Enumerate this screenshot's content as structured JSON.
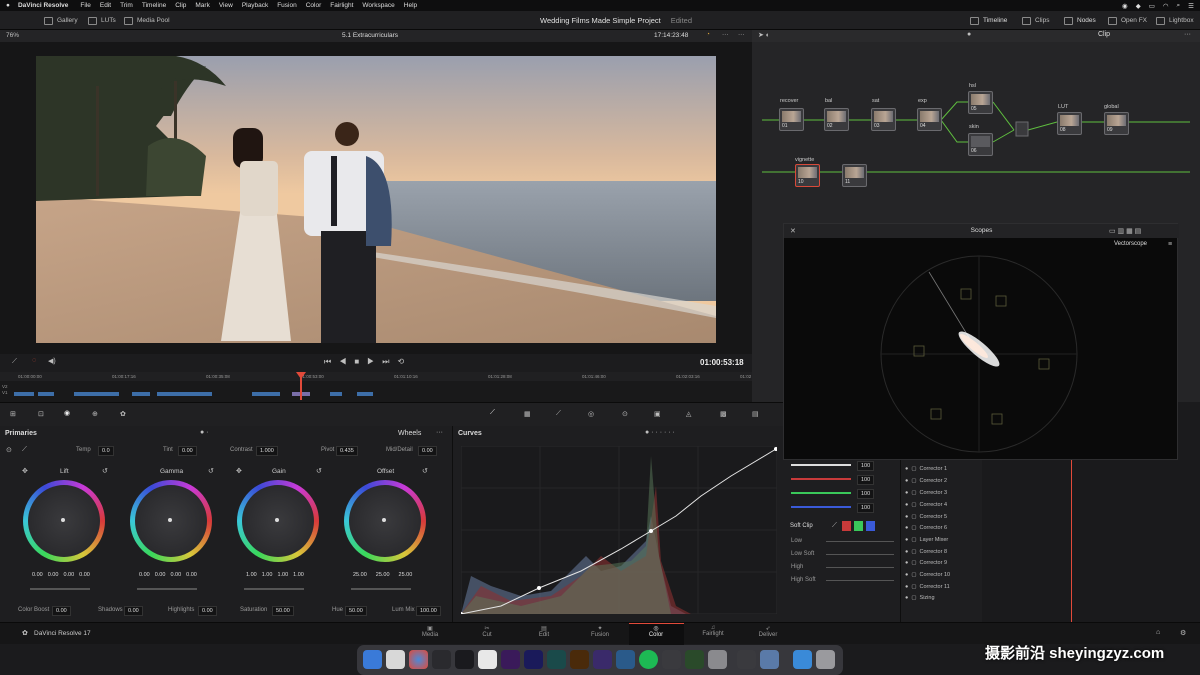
{
  "menubar": {
    "app": "DaVinci Resolve",
    "items": [
      "File",
      "Edit",
      "Trim",
      "Timeline",
      "Clip",
      "Mark",
      "View",
      "Playback",
      "Fusion",
      "Color",
      "Fairlight",
      "Workspace",
      "Help"
    ]
  },
  "toolbar": {
    "gallery": "Gallery",
    "luts": "LUTs",
    "media_pool": "Media Pool",
    "project_title": "Wedding Films Made Simple Project",
    "edited": "Edited",
    "timeline": "Timeline",
    "clips": "Clips",
    "nodes": "Nodes",
    "open_fx": "Open FX",
    "lightbox": "Lightbox"
  },
  "viewer": {
    "zoom": "76%",
    "timeline_name": "5.1 Extracurriculars",
    "timecode_top": "17:14:23:48",
    "timecode": "01:00:53:18"
  },
  "minitimeline": {
    "ticks": [
      "01:00:00:00",
      "01:00:17:16",
      "01:00:35:08",
      "01:00:53:00",
      "01:01:10:16",
      "01:01:28:08",
      "01:01:46:00",
      "01:02:03:16",
      "01:02"
    ],
    "tracks": [
      "V2",
      "V1"
    ]
  },
  "nodes": {
    "mode": "Clip",
    "items": [
      {
        "label": "recover",
        "num": "01"
      },
      {
        "label": "bal",
        "num": "02"
      },
      {
        "label": "sat",
        "num": "03"
      },
      {
        "label": "exp",
        "num": "04"
      },
      {
        "label": "hsl",
        "num": "05"
      },
      {
        "label": "skin",
        "num": "06"
      },
      {
        "label": "LUT",
        "num": "08"
      },
      {
        "label": "global",
        "num": "09"
      },
      {
        "label": "vignette",
        "num": "10"
      },
      {
        "label": "",
        "num": "11"
      }
    ]
  },
  "scopes": {
    "title": "Scopes",
    "type": "Vectorscope"
  },
  "primaries": {
    "title": "Primaries",
    "mode": "Wheels",
    "temp_label": "Temp",
    "temp": "0.0",
    "tint_label": "Tint",
    "tint": "0.00",
    "contrast_label": "Contrast",
    "contrast": "1.000",
    "pivot_label": "Pivot",
    "pivot": "0.435",
    "middetail_label": "Mid/Detail",
    "middetail": "0.00",
    "wheels": [
      {
        "name": "Lift",
        "vals": [
          "0.00",
          "0.00",
          "0.00",
          "0.00"
        ]
      },
      {
        "name": "Gamma",
        "vals": [
          "0.00",
          "0.00",
          "0.00",
          "0.00"
        ]
      },
      {
        "name": "Gain",
        "vals": [
          "1.00",
          "1.00",
          "1.00",
          "1.00"
        ]
      },
      {
        "name": "Offset",
        "vals": [
          "25.00",
          "25.00",
          "25.00"
        ]
      }
    ],
    "colorboost_label": "Color Boost",
    "colorboost": "0.00",
    "shadows_label": "Shadows",
    "shadows": "0.00",
    "highlights_label": "Highlights",
    "highlights": "0.00",
    "saturation_label": "Saturation",
    "saturation": "50.00",
    "hue_label": "Hue",
    "hue": "50.00",
    "lummix_label": "Lum Mix",
    "lummix": "100.00"
  },
  "curves": {
    "title": "Curves"
  },
  "curve_channels": [
    "100",
    "100",
    "100",
    "100"
  ],
  "softclip": {
    "title": "Soft Clip",
    "low": "Low",
    "lowsoft": "Low Soft",
    "high": "High",
    "highsoft": "High Soft"
  },
  "layers": [
    "Corrector 1",
    "Corrector 2",
    "Corrector 3",
    "Corrector 4",
    "Corrector 5",
    "Corrector 6",
    "Layer Mixer",
    "Corrector 8",
    "Corrector 9",
    "Corrector 10",
    "Corrector 11",
    "Sizing"
  ],
  "pagenav": {
    "brand": "DaVinci Resolve 17",
    "pages": [
      "Media",
      "Cut",
      "Edit",
      "Fusion",
      "Color",
      "Fairlight",
      "Deliver"
    ],
    "active": "Color"
  },
  "watermark": "摄影前沿 sheyingzyz.com",
  "colors": {
    "accent": "#e24a3a",
    "active_page": "#e8e8e8",
    "node_link": "#5fbf3f"
  }
}
